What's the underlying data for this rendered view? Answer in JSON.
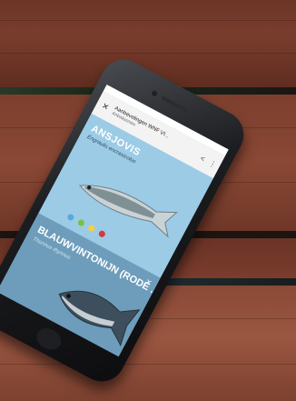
{
  "app_bar": {
    "close_icon": "close-icon",
    "title": "Aanbevelingen WNF VI...",
    "subtitle": "Anbalisomex",
    "share_icon": "share-icon",
    "menu_icon": "more-vert-icon"
  },
  "cards": [
    {
      "name": "ANSJOVIS",
      "latin": "Engraulis encrasicolus",
      "rating_colors": [
        "#5aa9dc",
        "#7bc043",
        "#f4d03f",
        "#d9363e"
      ]
    },
    {
      "name": "BLAUWVINTONIJN (RODE ...",
      "latin": "Thunnus thynnus",
      "close_icon": "close-icon"
    }
  ],
  "colors": {
    "card_top_bg": "#9ccbe6",
    "card_bottom_bg": "#6d9dbb",
    "wood": "#7d3f2e"
  }
}
